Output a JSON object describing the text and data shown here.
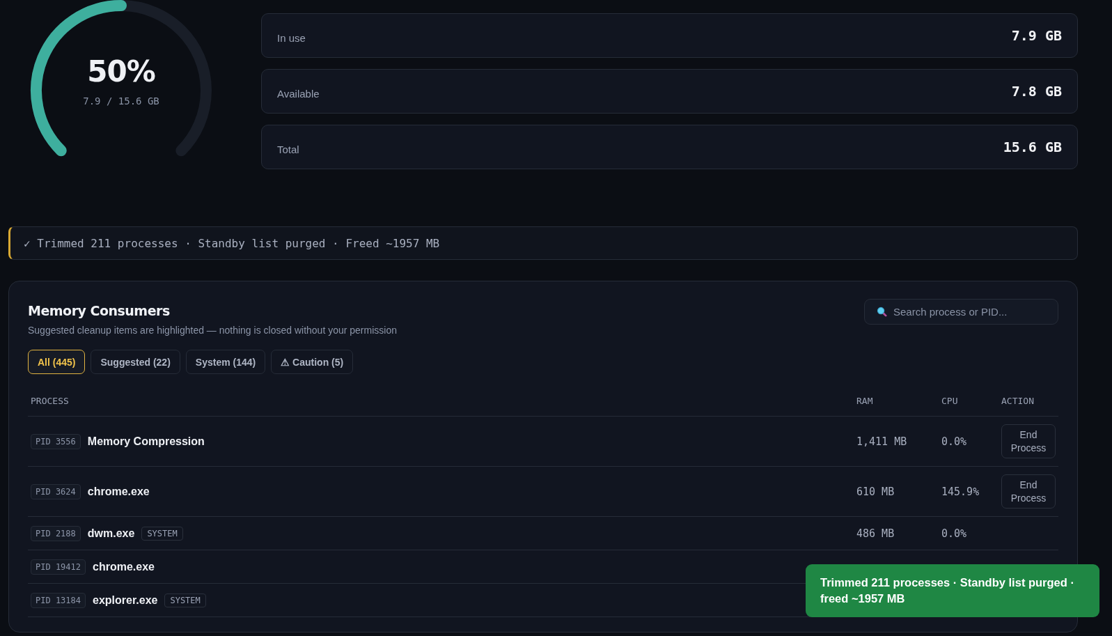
{
  "gauge": {
    "level": 0.5,
    "percent": "50%",
    "detail": "7.9 / 15.6 GB"
  },
  "stats": [
    {
      "label": "In use",
      "value": "7.9 GB"
    },
    {
      "label": "Available",
      "value": "7.8 GB"
    },
    {
      "label": "Total",
      "value": "15.6 GB"
    }
  ],
  "banner": {
    "text": "✓ Trimmed 211 processes · Standby list purged · Freed ~1957 MB"
  },
  "consumers": {
    "title": "Memory Consumers",
    "subtitle": "Suggested cleanup items are highlighted — nothing is closed without your permission",
    "search": {
      "placeholder": "Search process or PID..."
    },
    "filters": [
      {
        "label": "All (445)",
        "selected": true
      },
      {
        "label": "Suggested (22)",
        "selected": false
      },
      {
        "label": "System (144)",
        "selected": false
      },
      {
        "label": "⚠ Caution (5)",
        "selected": false
      }
    ],
    "columns": [
      "PROCESS",
      "RAM",
      "CPU",
      "ACTION"
    ],
    "rows": [
      {
        "pid": "PID 3556",
        "name": "Memory Compression",
        "ram": "1,411 MB",
        "cpu": "0.0%",
        "action": "End Process"
      },
      {
        "pid": "PID 3624",
        "name": "chrome.exe",
        "ram": "610 MB",
        "cpu": "145.9%",
        "action": "End Process"
      },
      {
        "pid": "PID 2188",
        "name": "dwm.exe",
        "tag": "SYSTEM",
        "ram": "486 MB",
        "cpu": "0.0%"
      },
      {
        "pid": "PID 19412",
        "name": "chrome.exe"
      },
      {
        "pid": "PID 13184",
        "name": "explorer.exe",
        "tag": "SYSTEM"
      }
    ]
  },
  "toast": {
    "text": "Trimmed 211 processes · Standby list purged · freed ~1957 MB"
  }
}
